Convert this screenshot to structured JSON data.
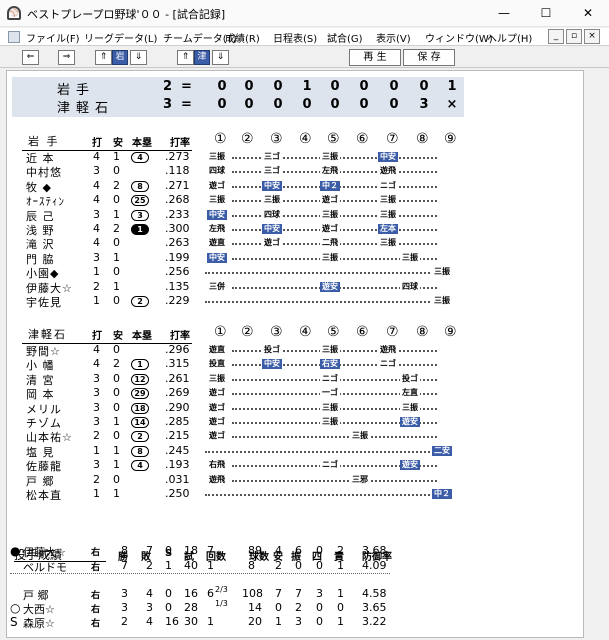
{
  "window": {
    "title": "ベストプレープロ野球'００ - [試合記録]",
    "min": "—",
    "max": "☐",
    "close": "✕"
  },
  "menu": [
    "ファイル(F)",
    "リーグデータ(L)",
    "チームデータ(T)",
    "成績(R)",
    "日程表(S)",
    "試合(G)",
    "表示(V)",
    "ウィンドウ(W)",
    "ヘルプ(H)"
  ],
  "mdi": [
    "_",
    "▫",
    "×"
  ],
  "toolbar": {
    "prev": "⇐",
    "next": "⇒",
    "up1": "⇑",
    "iwate": "岩",
    "down1": "⇓",
    "up2": "⇑",
    "tsugaru": "津",
    "down2": "⇓",
    "replay": "再 生",
    "save": "保 存"
  },
  "score": {
    "teams": [
      {
        "name": "岩手",
        "total": "2",
        "eq": "=",
        "innings": [
          "0",
          "0",
          "0",
          "1",
          "0",
          "0",
          "0",
          "0",
          "1"
        ]
      },
      {
        "name": "津軽石",
        "total": "3",
        "eq": "=",
        "innings": [
          "0",
          "0",
          "0",
          "0",
          "0",
          "0",
          "0",
          "3",
          "×"
        ]
      }
    ]
  },
  "inning_labels": [
    "①",
    "②",
    "③",
    "④",
    "⑤",
    "⑥",
    "⑦",
    "⑧",
    "⑨"
  ],
  "iwate": {
    "team": "岩 手",
    "headers": [
      "打",
      "安",
      "本塁",
      "打率"
    ],
    "rows": [
      {
        "name": "近 本",
        "ab": "4",
        "h": "1",
        "hr": "4",
        "hrstyle": "o",
        "avg": ".273",
        "res": [
          [
            "三振",
            ""
          ],
          [
            "三ゴ",
            ""
          ],
          [
            "三振",
            ""
          ],
          [
            "中安",
            "hl"
          ]
        ]
      },
      {
        "name": "中村悠",
        "ab": "3",
        "h": "0",
        "hr": "",
        "hrstyle": "",
        "avg": ".118",
        "res": [
          [
            "四球",
            ""
          ],
          [
            "三ゴ",
            ""
          ],
          [
            "左飛",
            ""
          ],
          [
            "遊飛",
            ""
          ]
        ]
      },
      {
        "name": "牧 ◆",
        "ab": "4",
        "h": "2",
        "hr": "8",
        "hrstyle": "o",
        "avg": ".271",
        "res": [
          [
            "遊ゴ",
            ""
          ],
          [
            "中安",
            "hl"
          ],
          [
            "中２",
            "hl"
          ],
          [
            "ニゴ",
            ""
          ]
        ]
      },
      {
        "name": "ｵｰｽﾃｨﾝ",
        "ab": "4",
        "h": "0",
        "hr": "25",
        "hrstyle": "o",
        "avg": ".268",
        "res": [
          [
            "三振",
            ""
          ],
          [
            "三振",
            ""
          ],
          [
            "遊ゴ",
            ""
          ],
          [
            "三振",
            ""
          ]
        ]
      },
      {
        "name": "辰 己",
        "ab": "3",
        "h": "1",
        "hr": "3",
        "hrstyle": "o",
        "avg": ".233",
        "res": [
          [
            "中安",
            "hl"
          ],
          [
            "四球",
            ""
          ],
          [
            "三振",
            ""
          ],
          [
            "三振",
            ""
          ]
        ]
      },
      {
        "name": "浅 野",
        "ab": "4",
        "h": "2",
        "hr": "1",
        "hrstyle": "f",
        "avg": ".300",
        "res": [
          [
            "左飛",
            ""
          ],
          [
            "中安",
            "hl"
          ],
          [
            "遊ゴ",
            ""
          ],
          [
            "左本",
            "hl"
          ]
        ]
      },
      {
        "name": "滝 沢",
        "ab": "4",
        "h": "0",
        "hr": "",
        "hrstyle": "",
        "avg": ".263",
        "res": [
          [
            "遊直",
            ""
          ],
          [
            "遊ゴ",
            ""
          ],
          [
            "二飛",
            ""
          ],
          [
            "三振",
            ""
          ]
        ]
      },
      {
        "name": "門 脇",
        "ab": "3",
        "h": "1",
        "hr": "",
        "hrstyle": "",
        "avg": ".199",
        "res": [
          [
            "中安",
            "hl"
          ],
          [
            "三振",
            ""
          ],
          [
            "三振",
            ""
          ]
        ]
      },
      {
        "name": "小園◆",
        "ab": "1",
        "h": "0",
        "hr": "",
        "hrstyle": "",
        "avg": ".256",
        "res": [
          [
            "三振",
            ""
          ]
        ]
      },
      {
        "name": "伊藤大☆",
        "ab": "2",
        "h": "1",
        "hr": "",
        "hrstyle": "",
        "avg": ".135",
        "res": [
          [
            "三併",
            ""
          ],
          [
            "遊安",
            "hl"
          ],
          [
            "四球",
            ""
          ]
        ]
      },
      {
        "name": "宇佐見",
        "ab": "1",
        "h": "0",
        "hr": "2",
        "hrstyle": "o",
        "avg": ".229",
        "res": [
          [
            "三振",
            ""
          ]
        ]
      }
    ]
  },
  "tsugaru": {
    "team": "津軽石",
    "headers": [
      "打",
      "安",
      "本塁",
      "打率"
    ],
    "rows": [
      {
        "name": "野間☆",
        "ab": "4",
        "h": "0",
        "hr": "",
        "hrstyle": "",
        "avg": ".296",
        "res": [
          [
            "遊直",
            ""
          ],
          [
            "投ゴ",
            ""
          ],
          [
            "三振",
            ""
          ],
          [
            "遊飛",
            ""
          ]
        ]
      },
      {
        "name": "小 幡",
        "ab": "4",
        "h": "2",
        "hr": "1",
        "hrstyle": "o",
        "avg": ".315",
        "res": [
          [
            "投直",
            ""
          ],
          [
            "中安",
            "hl"
          ],
          [
            "右安",
            "hl"
          ],
          [
            "ニゴ",
            ""
          ]
        ]
      },
      {
        "name": "清 宮",
        "ab": "3",
        "h": "0",
        "hr": "12",
        "hrstyle": "o",
        "avg": ".261",
        "res": [
          [
            "三振",
            ""
          ],
          [
            "ニゴ",
            ""
          ],
          [
            "投ゴ",
            ""
          ]
        ]
      },
      {
        "name": "岡 本",
        "ab": "3",
        "h": "0",
        "hr": "29",
        "hrstyle": "o",
        "avg": ".269",
        "res": [
          [
            "遊ゴ",
            ""
          ],
          [
            "一ゴ",
            ""
          ],
          [
            "左直",
            ""
          ]
        ]
      },
      {
        "name": "メリル",
        "ab": "3",
        "h": "0",
        "hr": "18",
        "hrstyle": "o",
        "avg": ".290",
        "res": [
          [
            "遊ゴ",
            ""
          ],
          [
            "三振",
            ""
          ],
          [
            "三振",
            ""
          ]
        ]
      },
      {
        "name": "チゾム",
        "ab": "3",
        "h": "1",
        "hr": "14",
        "hrstyle": "o",
        "avg": ".285",
        "res": [
          [
            "遊ゴ",
            ""
          ],
          [
            "三振",
            ""
          ],
          [
            "遊安",
            "hl"
          ]
        ]
      },
      {
        "name": "山本祐☆",
        "ab": "2",
        "h": "0",
        "hr": "2",
        "hrstyle": "o",
        "avg": ".215",
        "res": [
          [
            "遊ゴ",
            ""
          ],
          [
            "三振",
            ""
          ]
        ]
      },
      {
        "name": "塩 見",
        "ab": "1",
        "h": "1",
        "hr": "8",
        "hrstyle": "o",
        "avg": ".245",
        "res": [
          [
            "二安",
            "hl"
          ]
        ]
      },
      {
        "name": "佐藤龍",
        "ab": "3",
        "h": "1",
        "hr": "4",
        "hrstyle": "o",
        "avg": ".193",
        "res": [
          [
            "右飛",
            ""
          ],
          [
            "ニゴ",
            ""
          ],
          [
            "遊安",
            "hl"
          ]
        ]
      },
      {
        "name": "戸 郷",
        "ab": "2",
        "h": "0",
        "hr": "",
        "hrstyle": "",
        "avg": ".031",
        "res": [
          [
            "遊飛",
            ""
          ],
          [
            "三邪",
            ""
          ]
        ]
      },
      {
        "name": "松本直",
        "ab": "1",
        "h": "1",
        "hr": "",
        "hrstyle": "",
        "avg": ".250",
        "res": [
          [
            "中２",
            "hl"
          ]
        ]
      }
    ]
  },
  "pitching": {
    "title": "投手成績",
    "headers": [
      "勝",
      "敗",
      "S",
      "試",
      "回数",
      "球数",
      "安",
      "振",
      "四",
      "責",
      "防御率"
    ],
    "rows": [
      {
        "mark": "●",
        "name": "伊藤大☆",
        "hand": "右",
        "w": "8",
        "l": "7",
        "s": "0",
        "g": "18",
        "ip": "7",
        "ipf": "",
        "np": "89",
        "h": "4",
        "k": "6",
        "bb": "0",
        "er": "2",
        "era": "3.68"
      },
      {
        "mark": "",
        "name": "ベルドモ",
        "hand": "右",
        "w": "7",
        "l": "2",
        "s": "1",
        "g": "40",
        "ip": "1",
        "ipf": "",
        "np": "8",
        "h": "2",
        "k": "0",
        "bb": "0",
        "er": "1",
        "era": "4.09"
      },
      {
        "mark": "",
        "name": "戸 郷",
        "hand": "右",
        "w": "3",
        "l": "4",
        "s": "0",
        "g": "16",
        "ip": "6",
        "ipf": "2/3",
        "np": "108",
        "h": "7",
        "k": "7",
        "bb": "3",
        "er": "1",
        "era": "4.58"
      },
      {
        "mark": "○",
        "name": "大西☆",
        "hand": "右",
        "w": "3",
        "l": "3",
        "s": "0",
        "g": "28",
        "ip": "",
        "ipf": "1/3",
        "np": "14",
        "h": "0",
        "k": "2",
        "bb": "0",
        "er": "0",
        "era": "3.65"
      },
      {
        "mark": "S",
        "name": "森原☆",
        "hand": "右",
        "w": "2",
        "l": "4",
        "s": "16",
        "g": "30",
        "ip": "1",
        "ipf": "",
        "np": "20",
        "h": "1",
        "k": "3",
        "bb": "0",
        "er": "1",
        "era": "3.22"
      }
    ]
  }
}
